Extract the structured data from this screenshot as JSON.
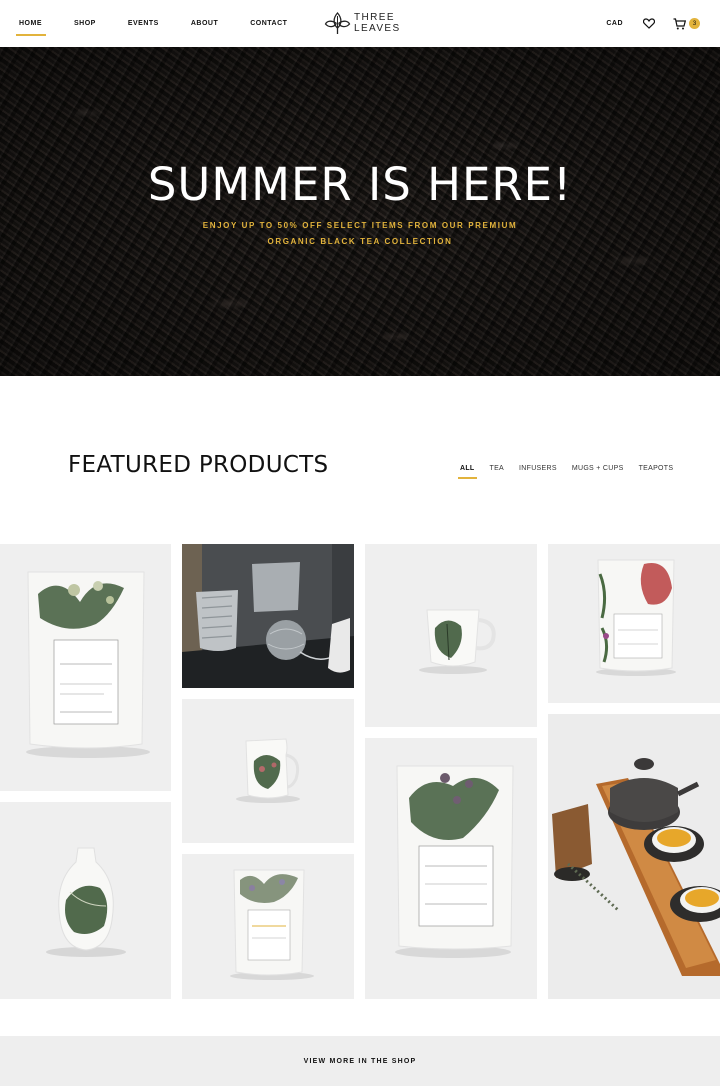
{
  "header": {
    "nav": [
      {
        "label": "HOME",
        "active": true
      },
      {
        "label": "SHOP",
        "active": false
      },
      {
        "label": "EVENTS",
        "active": false
      },
      {
        "label": "ABOUT",
        "active": false
      },
      {
        "label": "CONTACT",
        "active": false
      }
    ],
    "logo": {
      "line1": "THREE",
      "line2": "LEAVES"
    },
    "currency": "CAD",
    "cart_count": "3",
    "accent_color": "#e2b33c"
  },
  "hero": {
    "title": "SUMMER IS HERE!",
    "subtitle_line1": "ENJOY UP TO 50% OFF SELECT ITEMS FROM OUR PREMIUM",
    "subtitle_line2": "ORGANIC BLACK TEA COLLECTION"
  },
  "featured": {
    "title": "FEATURED PRODUCTS",
    "filters": [
      {
        "label": "ALL",
        "active": true
      },
      {
        "label": "TEA",
        "active": false
      },
      {
        "label": "INFUSERS",
        "active": false
      },
      {
        "label": "MUGS + CUPS",
        "active": false
      },
      {
        "label": "TEAPOTS",
        "active": false
      }
    ],
    "products": [
      {
        "name": "tea-pouch-large",
        "icon": "pouch-icon"
      },
      {
        "name": "tea-infuser",
        "icon": "infuser-icon"
      },
      {
        "name": "botanical-cup",
        "icon": "cup-icon"
      },
      {
        "name": "tea-pouch-floral",
        "icon": "pouch-icon"
      },
      {
        "name": "botanical-jug",
        "icon": "jug-icon"
      },
      {
        "name": "botanical-vase",
        "icon": "vase-icon"
      },
      {
        "name": "tea-pouch-berry",
        "icon": "pouch-icon"
      },
      {
        "name": "tea-pouch-mint",
        "icon": "pouch-icon"
      },
      {
        "name": "teapot-tray",
        "icon": "teapot-icon"
      }
    ]
  },
  "footer_cta": {
    "label": "VIEW MORE IN THE SHOP"
  }
}
